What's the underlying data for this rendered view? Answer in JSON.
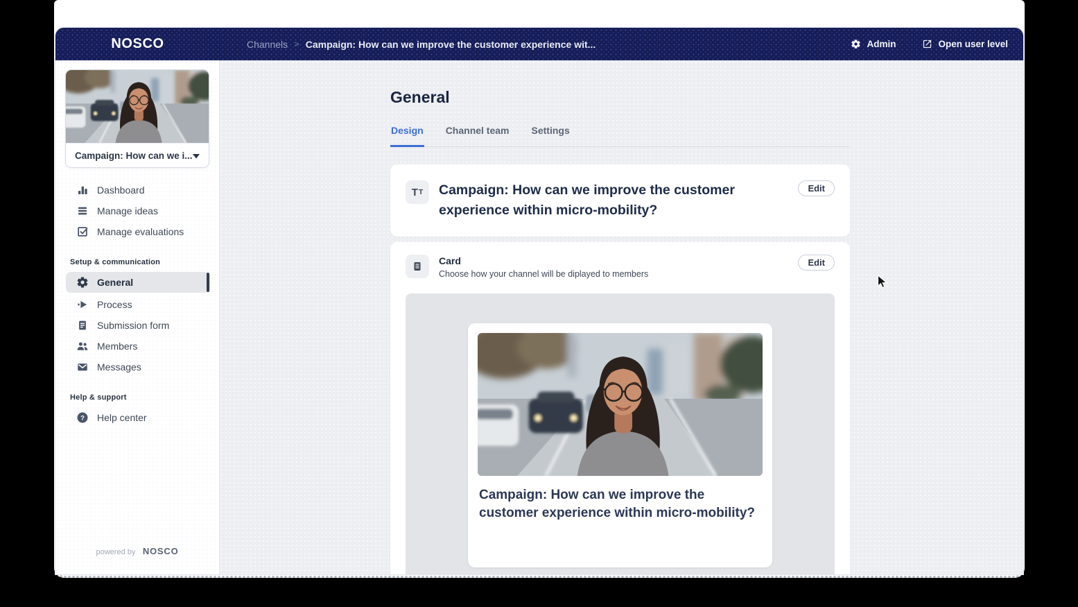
{
  "header": {
    "logo": "NOSCO",
    "breadcrumb": {
      "parent": "Channels",
      "separator": ">",
      "current": "Campaign: How can we improve the customer experience wit..."
    },
    "actions": {
      "admin": "Admin",
      "open_user_level": "Open user level"
    }
  },
  "sidebar": {
    "selector": {
      "label": "Campaign: How can we i..."
    },
    "nav_top": [
      {
        "label": "Dashboard",
        "icon": "bar-chart-icon"
      },
      {
        "label": "Manage ideas",
        "icon": "stack-icon"
      },
      {
        "label": "Manage evaluations",
        "icon": "check-square-icon"
      }
    ],
    "setup_section": {
      "title": "Setup & communication",
      "items": [
        {
          "label": "General",
          "icon": "gear-icon",
          "active": true
        },
        {
          "label": "Process",
          "icon": "arrow-right-icon"
        },
        {
          "label": "Submission form",
          "icon": "document-icon"
        },
        {
          "label": "Members",
          "icon": "users-icon"
        },
        {
          "label": "Messages",
          "icon": "envelope-icon"
        }
      ]
    },
    "help_section": {
      "title": "Help & support",
      "items": [
        {
          "label": "Help center",
          "icon": "question-icon"
        }
      ]
    },
    "footer": {
      "powered_by": "powered by",
      "brand": "NOSCO"
    }
  },
  "main": {
    "page_title": "General",
    "tabs": [
      {
        "label": "Design",
        "active": true
      },
      {
        "label": "Channel team",
        "active": false
      },
      {
        "label": "Settings",
        "active": false
      }
    ],
    "title_block": {
      "icon_big": "T",
      "icon_small": "T",
      "heading": "Campaign: How can we improve the customer experience within micro-mobility?",
      "edit": "Edit"
    },
    "card_block": {
      "title": "Card",
      "subtitle": "Choose how your channel will be diplayed to members",
      "edit": "Edit"
    },
    "preview": {
      "title": "Campaign: How can we improve the customer experience within micro-mobility?"
    }
  },
  "colors": {
    "header_bg": "#161d57",
    "accent_blue": "#3e6fd6",
    "main_bg": "#eceef2",
    "active_item_bg": "#e4e6ea",
    "text_dark": "#202c49"
  }
}
